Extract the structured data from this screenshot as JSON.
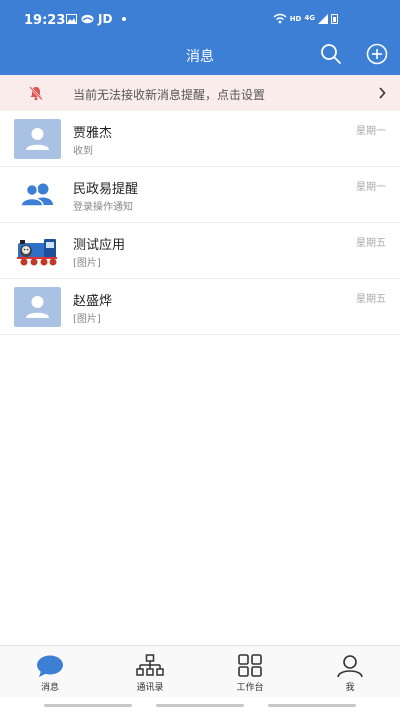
{
  "status_bar": {
    "time": "19:23",
    "carrier_label": "JD",
    "network_hd": "HD",
    "network_type": "4G"
  },
  "header": {
    "title": "消息",
    "search_icon": "search-icon",
    "add_icon": "plus-circle-icon",
    "bg_color": "#3d7fd4"
  },
  "notice": {
    "text": "当前无法接收新消息提醒，点击设置",
    "bg_color": "#fbecec"
  },
  "conversations": [
    {
      "name": "贾雅杰",
      "last_message": "收到",
      "time": "星期一",
      "avatar": "person"
    },
    {
      "name": "民政易提醒",
      "last_message": "登录操作通知",
      "time": "星期一",
      "avatar": "group"
    },
    {
      "name": "测试应用",
      "last_message": "[图片]",
      "time": "星期五",
      "avatar": "train"
    },
    {
      "name": "赵盛烨",
      "last_message": "[图片]",
      "time": "星期五",
      "avatar": "person"
    }
  ],
  "tabs": [
    {
      "label": "消息",
      "icon": "chat-bubble-icon",
      "active": true
    },
    {
      "label": "通讯录",
      "icon": "org-chart-icon",
      "active": false
    },
    {
      "label": "工作台",
      "icon": "grid-icon",
      "active": false
    },
    {
      "label": "我",
      "icon": "user-icon",
      "active": false
    }
  ]
}
